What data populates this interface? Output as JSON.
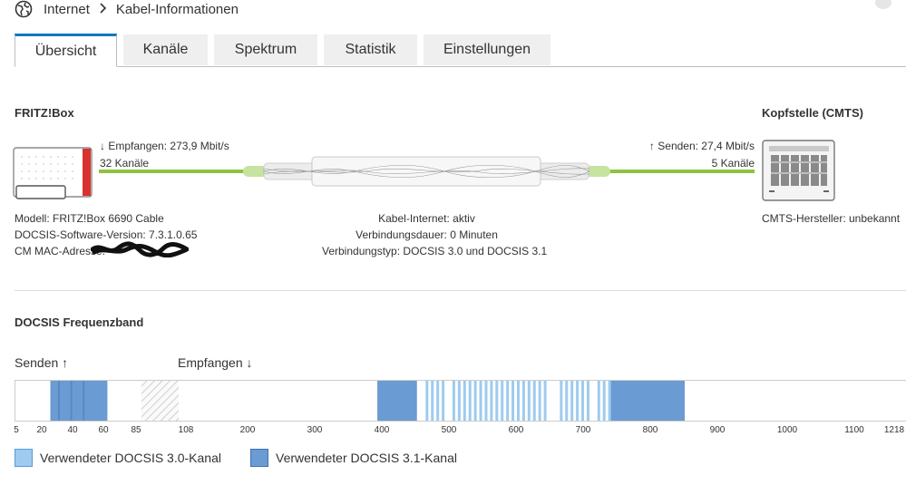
{
  "breadcrumb": {
    "root": "Internet",
    "current": "Kabel-Informationen"
  },
  "tabs": [
    {
      "label": "Übersicht",
      "active": true
    },
    {
      "label": "Kanäle"
    },
    {
      "label": "Spektrum"
    },
    {
      "label": "Statistik"
    },
    {
      "label": "Einstellungen"
    }
  ],
  "overview": {
    "left_title": "FRITZ!Box",
    "right_title": "Kopfstelle (CMTS)",
    "down_rate": "Empfangen: 273,9 Mbit/s",
    "down_channels": "32 Kanäle",
    "up_rate": "Senden: 27,4 Mbit/s",
    "up_channels": "5 Kanäle",
    "model": "Modell: FRITZ!Box 6690 Cable",
    "docsis_version": "DOCSIS-Software-Version: 7.3.1.0.65",
    "mac_label": "CM MAC-Adresse:",
    "cable_status": "Kabel-Internet: aktiv",
    "duration": "Verbindungsdauer: 0 Minuten",
    "conn_type": "Verbindungstyp: DOCSIS 3.0 und DOCSIS 3.1",
    "cmts_vendor": "CMTS-Hersteller: unbekannt"
  },
  "band": {
    "title": "DOCSIS Frequenzband",
    "send_label": "Senden",
    "receive_label": "Empfangen",
    "ticks": [
      "5",
      "20",
      "40",
      "60",
      "85",
      "108",
      "200",
      "300",
      "400",
      "500",
      "600",
      "700",
      "800",
      "900",
      "1000",
      "1100",
      "1218"
    ],
    "legend_30": "Verwendeter DOCSIS 3.0-Kanal",
    "legend_31": "Verwendeter DOCSIS 3.1-Kanal",
    "color_30": "#9ecbef",
    "color_31": "#6b9bd3",
    "ds30_channels_mhz": [
      466,
      474,
      482,
      490,
      506,
      514,
      522,
      530,
      538,
      546,
      554,
      562,
      570,
      578,
      586,
      594,
      602,
      610,
      618,
      626,
      634,
      642,
      666,
      674,
      682,
      690,
      698,
      706,
      722,
      730,
      738
    ],
    "ds31_blocks_mhz": [
      [
        392,
        451
      ],
      [
        738,
        850
      ]
    ],
    "us31_block_mhz": [
      25,
      62
    ]
  },
  "icons": {
    "globe": "globe-icon",
    "arrow_down": "arrow-down-icon",
    "arrow_up": "arrow-up-icon",
    "chevron": "chevron-right-icon"
  }
}
